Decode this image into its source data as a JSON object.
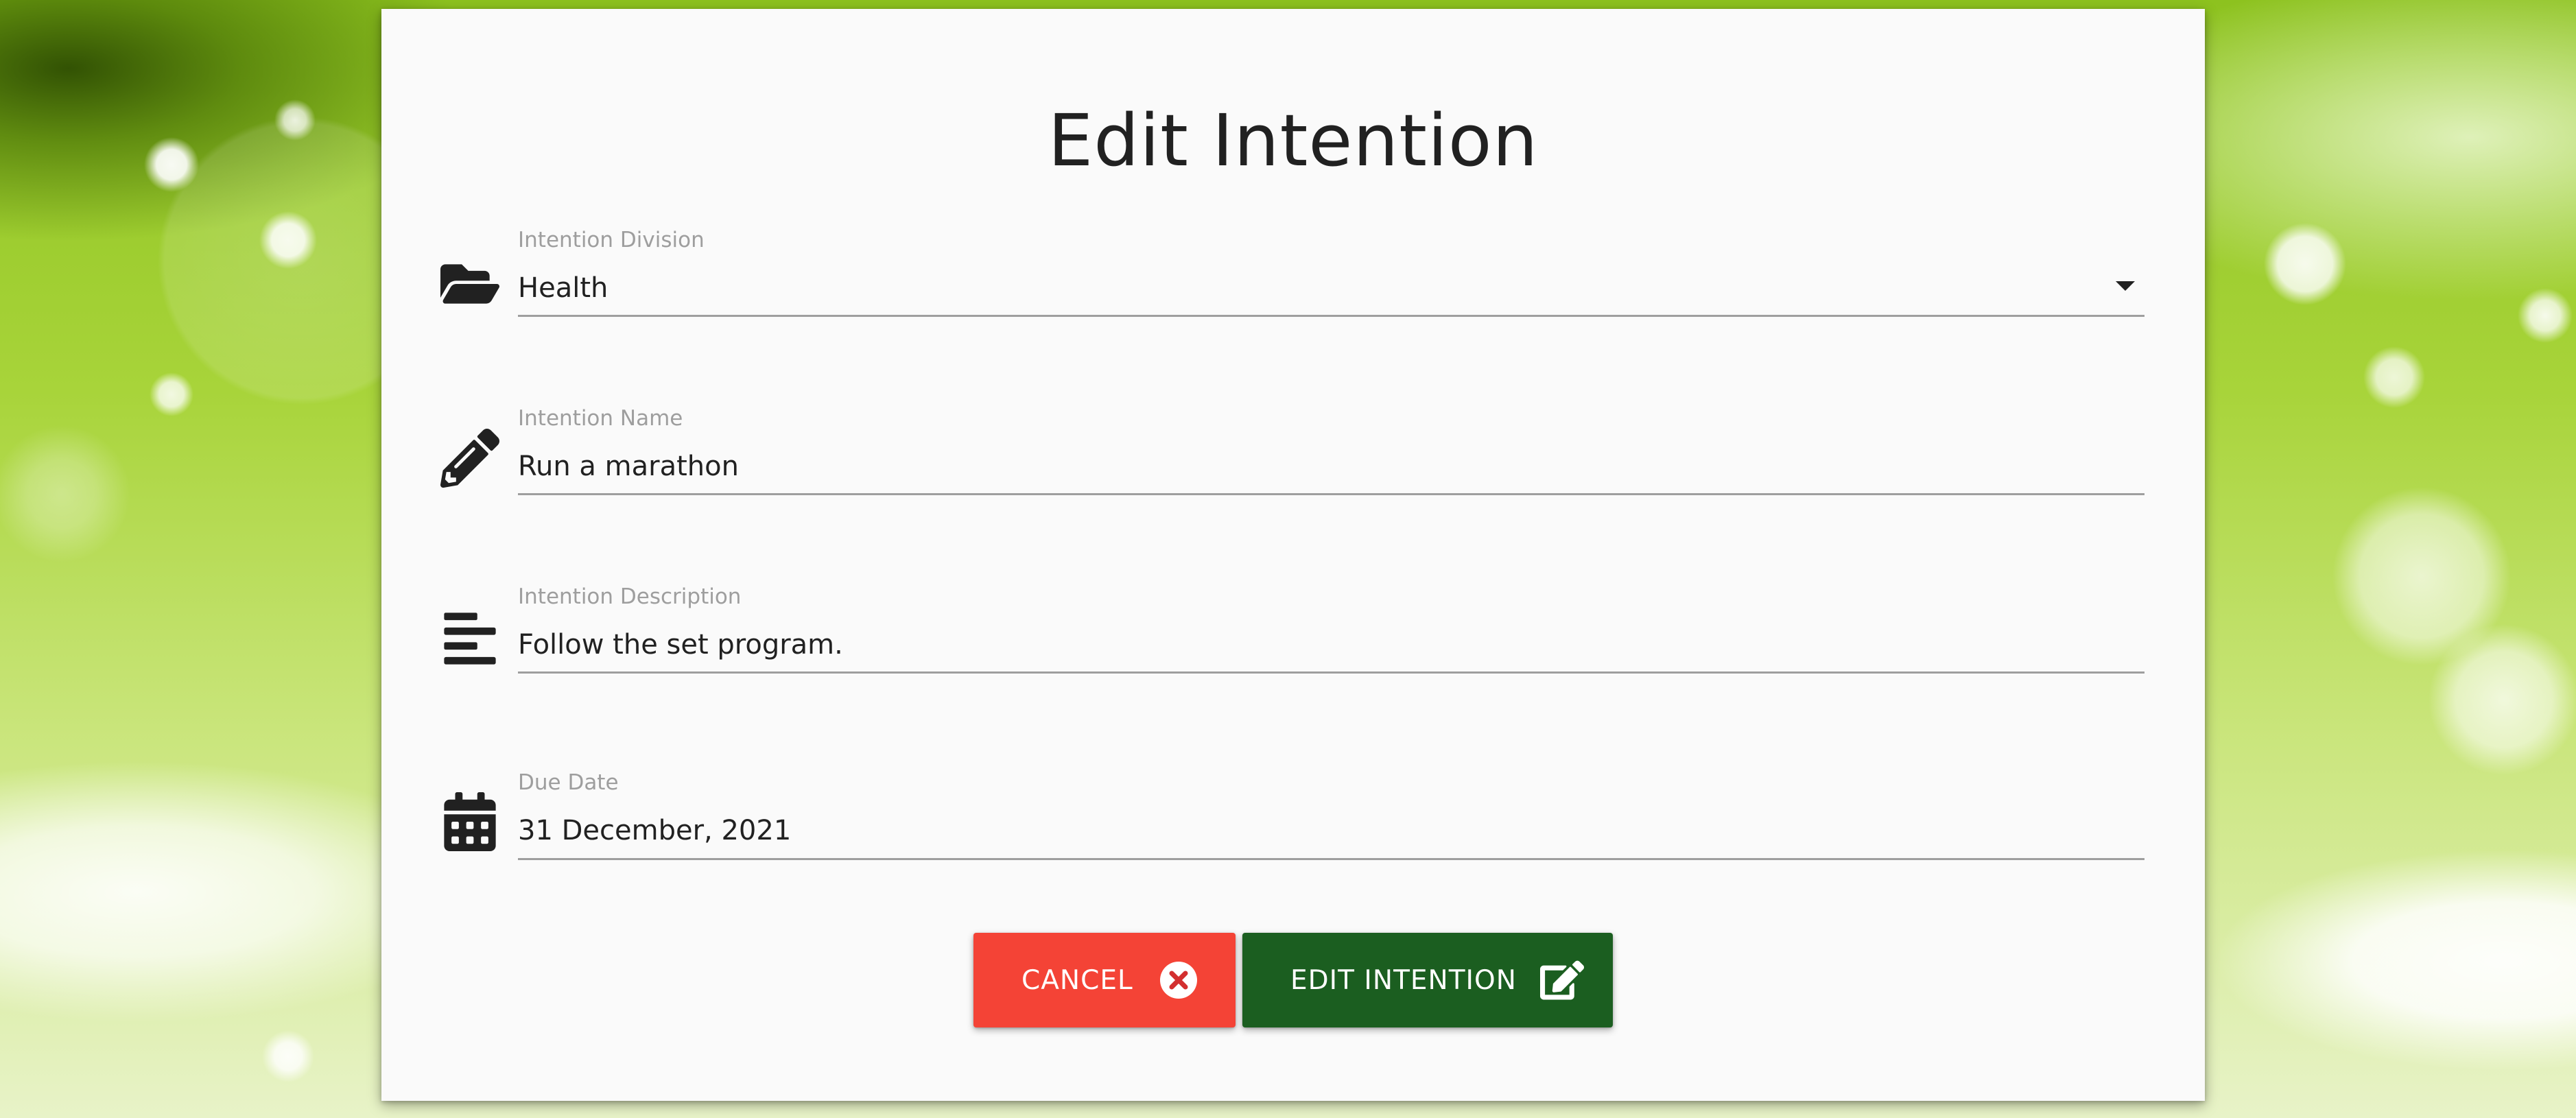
{
  "form": {
    "title": "Edit Intention",
    "fields": {
      "division": {
        "label": "Intention Division",
        "value": "Health",
        "icon": "folder-open-icon"
      },
      "name": {
        "label": "Intention Name",
        "value": "Run a marathon",
        "icon": "pencil-icon"
      },
      "description": {
        "label": "Intention Description",
        "value": "Follow the set program.",
        "icon": "align-left-icon"
      },
      "due_date": {
        "label": "Due Date",
        "value": "31 December, 2021",
        "icon": "calendar-icon"
      }
    },
    "buttons": {
      "cancel_label": "CANCEL",
      "cancel_icon": "times-circle-icon",
      "submit_label": "EDIT INTENTION",
      "submit_icon": "edit-icon"
    }
  },
  "colors": {
    "cancel": "#f44336",
    "submit": "#1b5e20",
    "label": "#9e9e9e",
    "text": "#212121",
    "card": "#fafafa"
  }
}
